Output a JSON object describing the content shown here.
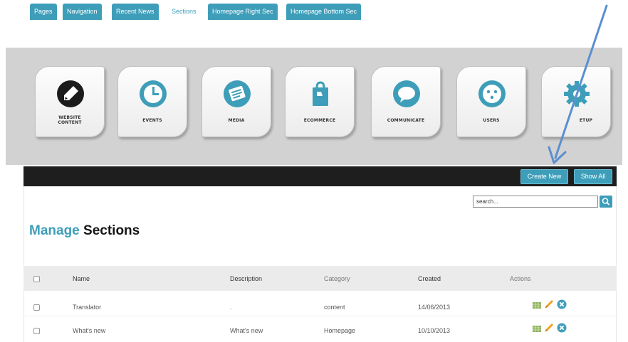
{
  "modules": [
    {
      "label_line1": "WEBSITE",
      "label_line2": "CONTENT",
      "icon": "pen-icon"
    },
    {
      "label_line1": "EVENTS",
      "label_line2": "",
      "icon": "clock-icon"
    },
    {
      "label_line1": "MEDIA",
      "label_line2": "",
      "icon": "media-icon"
    },
    {
      "label_line1": "ECOMMERCE",
      "label_line2": "",
      "icon": "shopping-bag-icon"
    },
    {
      "label_line1": "COMMUNICATE",
      "label_line2": "",
      "icon": "speech-bubble-icon"
    },
    {
      "label_line1": "USERS",
      "label_line2": "",
      "icon": "user-face-icon"
    },
    {
      "label_line1": "ETUP",
      "label_line2": "",
      "icon": "gear-icon"
    }
  ],
  "tabs": [
    "Pages",
    "Navigation",
    "Recent News",
    "Sections",
    "Homepage Right Sec",
    "Homepage Bottom Sec"
  ],
  "active_tab": "Sections",
  "header_buttons": {
    "create_new": "Create New",
    "show_all": "Show All"
  },
  "search": {
    "value": "search...",
    "icon": "search-icon"
  },
  "page_title": {
    "part1": "Manage",
    "part2": "Sections"
  },
  "table": {
    "columns": [
      "Name",
      "Description",
      "Category",
      "Created",
      "Actions"
    ],
    "rows": [
      {
        "name": "Translator",
        "description": ".",
        "category": "content",
        "created": "14/06/2013"
      },
      {
        "name": "What's new",
        "description": "What's new",
        "category": "Homepage",
        "created": "10/10/2013"
      }
    ],
    "action_icons": [
      "grid-icon",
      "pencil-icon",
      "delete-icon"
    ]
  },
  "colors": {
    "accent": "#3e9eb9",
    "tabbar": "#1e1e1e",
    "arrow": "#5b8fcf",
    "module_area": "#d2d2d2"
  }
}
